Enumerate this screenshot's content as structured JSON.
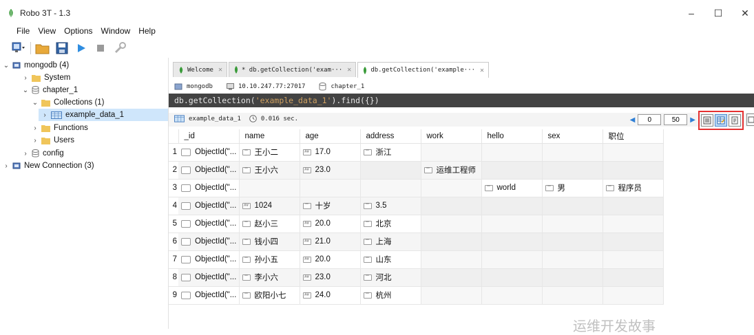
{
  "window": {
    "title": "Robo 3T - 1.3",
    "min": "–",
    "max": "☐",
    "close": "✕"
  },
  "menu": [
    "File",
    "View",
    "Options",
    "Window",
    "Help"
  ],
  "tree": {
    "root": "mongodb (4)",
    "system": "System",
    "db": "chapter_1",
    "collections": "Collections (1)",
    "collection": "example_data_1",
    "functions": "Functions",
    "users": "Users",
    "config": "config",
    "new_connection": "New Connection (3)"
  },
  "tabs": [
    {
      "label": "Welcome"
    },
    {
      "label": "* db.getCollection('exam···"
    },
    {
      "label": "db.getCollection('example···"
    }
  ],
  "connection": {
    "server": "mongodb",
    "address": "10.10.247.77:27017",
    "db": "chapter_1"
  },
  "query": {
    "prefix": "db.getCollection(",
    "arg": "'example_data_1'",
    "suffix": ").find({})"
  },
  "result": {
    "collection": "example_data_1",
    "time": "0.016 sec.",
    "skip": "0",
    "limit": "50"
  },
  "columns": [
    "_id",
    "name",
    "age",
    "address",
    "work",
    "hello",
    "sex",
    "职位"
  ],
  "rows": [
    {
      "n": "1",
      "id": "ObjectId(\"...",
      "name": "王小二",
      "age": "17.0",
      "address": "浙江",
      "work": "",
      "hello": "",
      "sex": "",
      "pos": ""
    },
    {
      "n": "2",
      "id": "ObjectId(\"...",
      "name": "王小六",
      "age": "23.0",
      "address": "",
      "work": "运维工程师",
      "hello": "",
      "sex": "",
      "pos": ""
    },
    {
      "n": "3",
      "id": "ObjectId(\"...",
      "name": "",
      "age": "",
      "address": "",
      "work": "",
      "hello": "world",
      "sex": "男",
      "pos": "程序员"
    },
    {
      "n": "4",
      "id": "ObjectId(\"...",
      "name": "1024",
      "age": "十岁",
      "address": "3.5",
      "work": "",
      "hello": "",
      "sex": "",
      "pos": ""
    },
    {
      "n": "5",
      "id": "ObjectId(\"...",
      "name": "赵小三",
      "age": "20.0",
      "address": "北京",
      "work": "",
      "hello": "",
      "sex": "",
      "pos": ""
    },
    {
      "n": "6",
      "id": "ObjectId(\"...",
      "name": "钱小四",
      "age": "21.0",
      "address": "上海",
      "work": "",
      "hello": "",
      "sex": "",
      "pos": ""
    },
    {
      "n": "7",
      "id": "ObjectId(\"...",
      "name": "孙小五",
      "age": "20.0",
      "address": "山东",
      "work": "",
      "hello": "",
      "sex": "",
      "pos": ""
    },
    {
      "n": "8",
      "id": "ObjectId(\"...",
      "name": "李小六",
      "age": "23.0",
      "address": "河北",
      "work": "",
      "hello": "",
      "sex": "",
      "pos": ""
    },
    {
      "n": "9",
      "id": "ObjectId(\"...",
      "name": "欧阳小七",
      "age": "24.0",
      "address": "杭州",
      "work": "",
      "hello": "",
      "sex": "",
      "pos": ""
    }
  ],
  "cell_types": {
    "string": "\"\"",
    "number": "##"
  },
  "watermark": "运维开发故事",
  "colors": {
    "query_bg": "#434343",
    "highlight_border": "#e53030",
    "selected_row": "#cfe6fb",
    "leaf_green": "#3a9b3a"
  }
}
